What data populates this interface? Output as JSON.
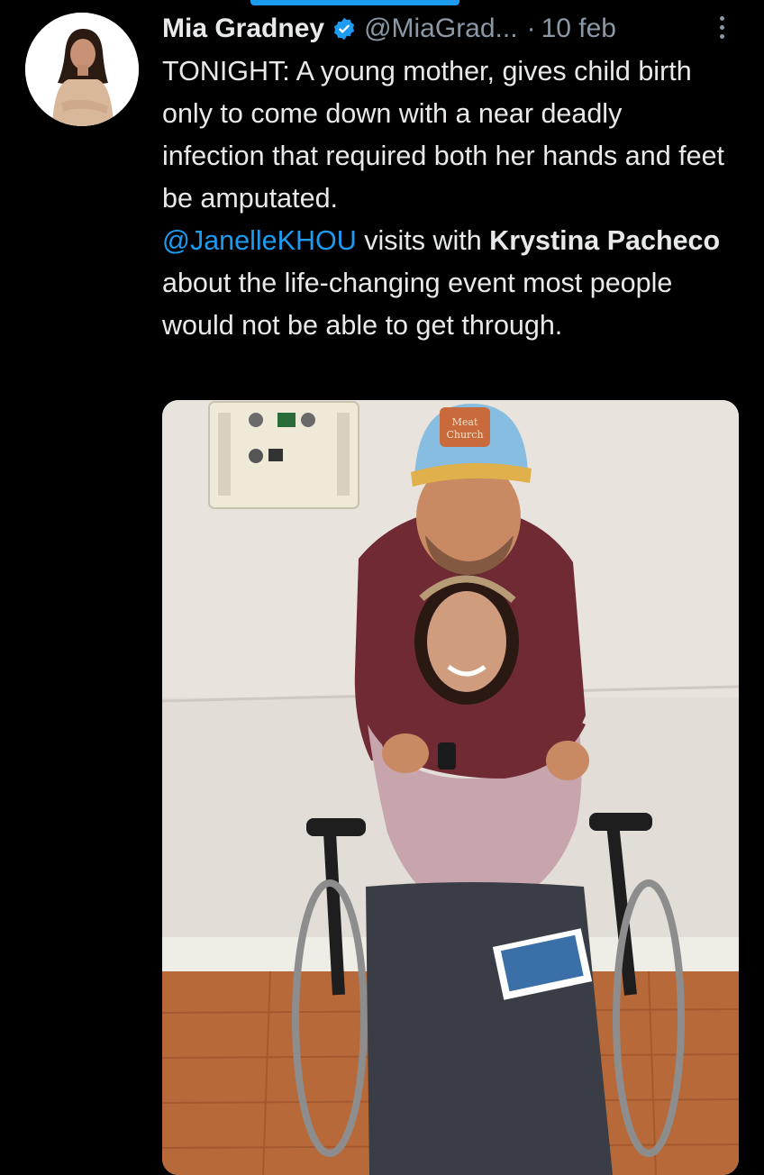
{
  "top_indicator": {
    "color": "#1d9bf0"
  },
  "tweet": {
    "author": {
      "display_name": "Mia Gradney",
      "handle": "@MiaGrad...",
      "verified": true,
      "avatar_icon": "profile-photo"
    },
    "separator": "·",
    "date": "10 feb",
    "more_icon": "more-vertical-icon",
    "text": {
      "intro": "TONIGHT:  A young mother, gives child birth only to come down with a near deadly infection that required both her hands and feet be amputated.",
      "mention": "@JanelleKHOU",
      "middle": " visits with ",
      "bold_name": "Krystina Pacheco",
      "outro": " about the life-changing event most people would not be able to get through."
    },
    "media": {
      "type": "photo",
      "cap_patch_text": "Meat Church"
    }
  },
  "colors": {
    "background": "#000000",
    "text": "#e7e9ea",
    "secondary": "#8b98a5",
    "link": "#1d9bf0"
  }
}
